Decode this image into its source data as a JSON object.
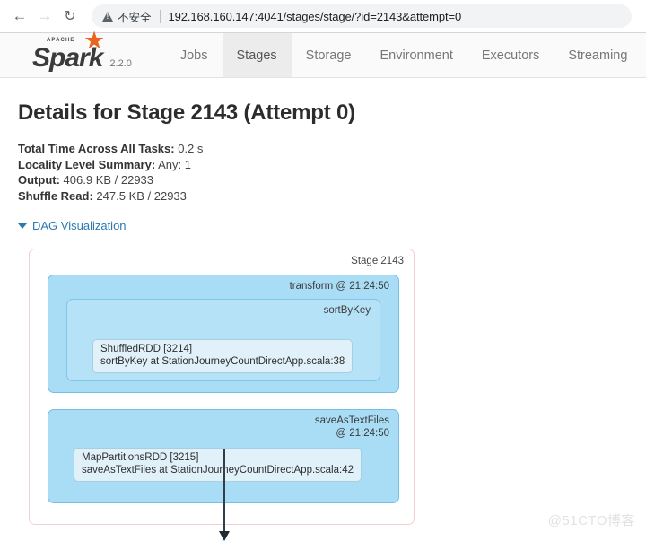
{
  "browser": {
    "back_icon": "back-arrow-icon",
    "forward_icon": "forward-arrow-icon",
    "reload_icon": "reload-icon",
    "back_glyph": "←",
    "forward_glyph": "→",
    "reload_glyph": "↻",
    "security_label": "不安全",
    "url": "192.168.160.147:4041/stages/stage/?id=2143&attempt=0"
  },
  "navbar": {
    "brand": {
      "apache": "APACHE",
      "name": "Spark",
      "version": "2.2.0",
      "star_glyph": "★"
    },
    "tabs": [
      {
        "label": "Jobs",
        "active": false
      },
      {
        "label": "Stages",
        "active": true
      },
      {
        "label": "Storage",
        "active": false
      },
      {
        "label": "Environment",
        "active": false
      },
      {
        "label": "Executors",
        "active": false
      },
      {
        "label": "Streaming",
        "active": false
      }
    ]
  },
  "main": {
    "title": "Details for Stage 2143 (Attempt 0)",
    "summary": [
      {
        "key": "Total Time Across All Tasks:",
        "value": "0.2 s"
      },
      {
        "key": "Locality Level Summary:",
        "value": "Any: 1"
      },
      {
        "key": "Output:",
        "value": "406.9 KB / 22933"
      },
      {
        "key": "Shuffle Read:",
        "value": "247.5 KB / 22933"
      }
    ],
    "dag_toggle_label": "DAG Visualization"
  },
  "dag": {
    "stage_label": "Stage 2143",
    "cluster_transform_label": "transform @ 21:24:50",
    "cluster_sortbykey_label": "sortByKey",
    "cluster_savetext_label_line1": "saveAsTextFiles",
    "cluster_savetext_label_line2": "@ 21:24:50",
    "node_shuffled_line1": "ShuffledRDD [3214]",
    "node_shuffled_line2": "sortByKey at StationJourneyCountDirectApp.scala:38",
    "node_mappart_line1": "MapPartitionsRDD [3215]",
    "node_mappart_line2": "saveAsTextFiles at StationJourneyCountDirectApp.scala:42"
  },
  "watermark": "@51CTO博客"
}
